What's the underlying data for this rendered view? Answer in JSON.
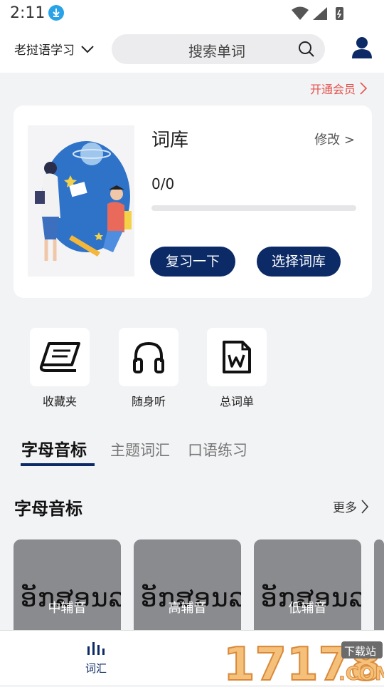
{
  "status": {
    "time": "2:11"
  },
  "header": {
    "language": "老挝语学习",
    "search_placeholder": "搜索单词"
  },
  "vip_link": "开通会员",
  "wordbank": {
    "title": "词库",
    "edit": "修改 >",
    "progress": "0/0",
    "progress_fraction": 0,
    "review_button": "复习一下",
    "choose_button": "选择词库"
  },
  "tools": [
    {
      "label": "收藏夹",
      "icon": "book-icon"
    },
    {
      "label": "随身听",
      "icon": "headphones-icon"
    },
    {
      "label": "总词单",
      "icon": "word-doc-icon"
    }
  ],
  "tabs": [
    {
      "label": "字母音标",
      "active": true
    },
    {
      "label": "主题词汇",
      "active": false
    },
    {
      "label": "口语练习",
      "active": false
    }
  ],
  "section": {
    "title": "字母音标",
    "more": "更多"
  },
  "letter_cards": [
    {
      "lao": "ອັກສອນລາວ",
      "label": "中辅音"
    },
    {
      "lao": "ອັກສອນລາວ",
      "label": "高辅音"
    },
    {
      "lao": "ອັກສອນລາວ",
      "label": "低辅音"
    }
  ],
  "bottom_nav": {
    "vocab": "词汇"
  },
  "watermark": {
    "number": "17178",
    "badge": "下载站",
    "suffix": ".COM"
  },
  "colors": {
    "primary": "#0b2a66",
    "vip": "#e5504a",
    "background": "#f2f3f5"
  }
}
